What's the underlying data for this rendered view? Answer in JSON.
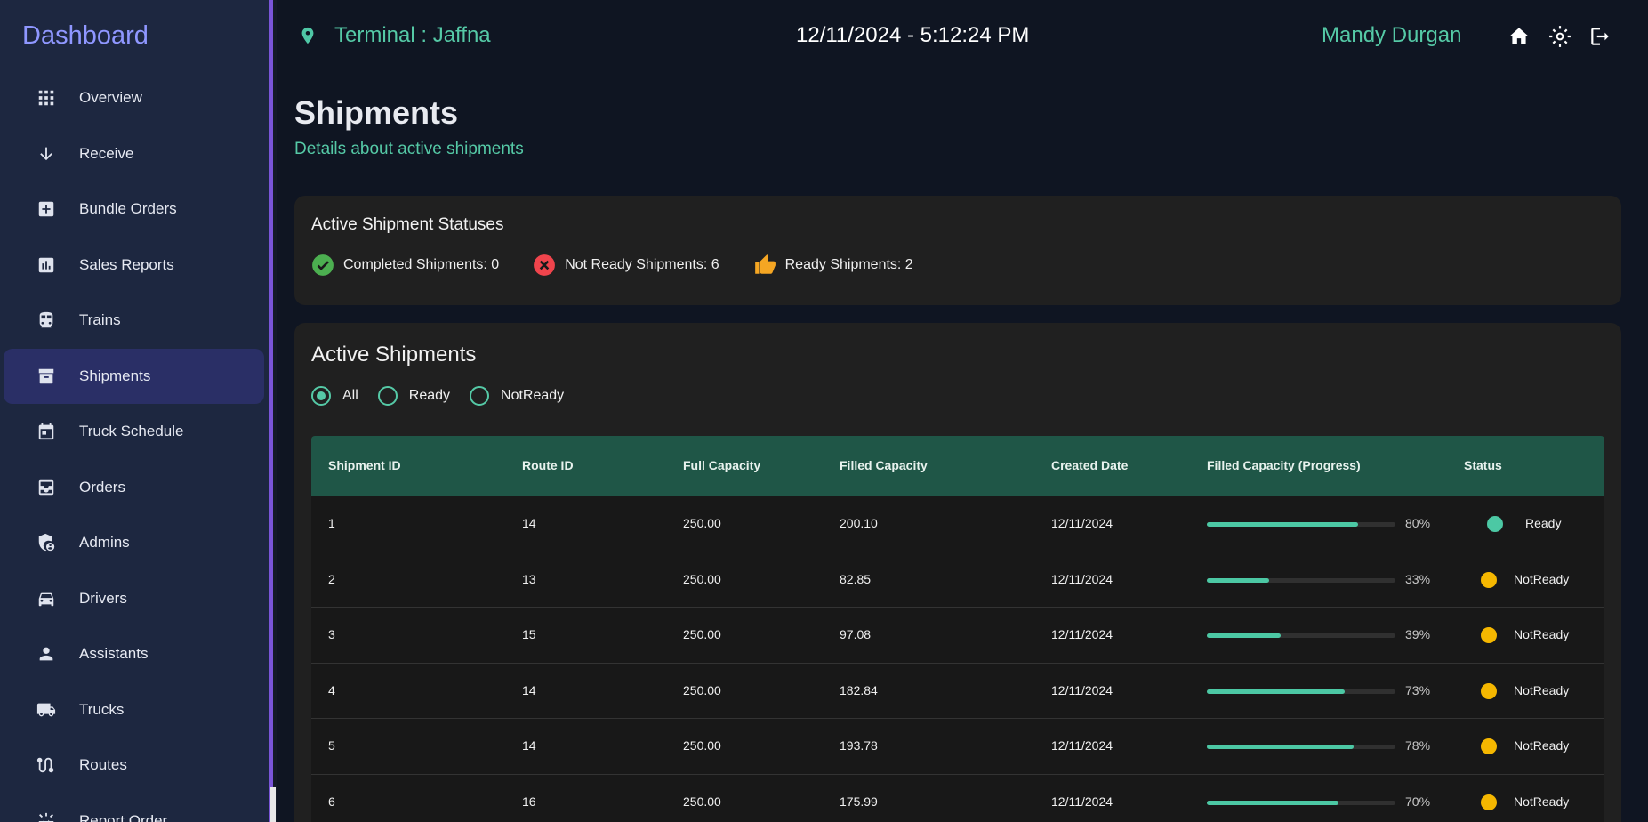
{
  "sidebar": {
    "title": "Dashboard",
    "items": [
      {
        "label": "Overview",
        "icon": "grid-icon"
      },
      {
        "label": "Receive",
        "icon": "arrow-down-icon"
      },
      {
        "label": "Bundle Orders",
        "icon": "add-box-icon"
      },
      {
        "label": "Sales Reports",
        "icon": "bar-chart-icon"
      },
      {
        "label": "Trains",
        "icon": "train-icon"
      },
      {
        "label": "Shipments",
        "icon": "archive-icon"
      },
      {
        "label": "Truck Schedule",
        "icon": "calendar-icon"
      },
      {
        "label": "Orders",
        "icon": "inbox-icon"
      },
      {
        "label": "Admins",
        "icon": "admin-shield-icon"
      },
      {
        "label": "Drivers",
        "icon": "car-icon"
      },
      {
        "label": "Assistants",
        "icon": "person-icon"
      },
      {
        "label": "Trucks",
        "icon": "truck-icon"
      },
      {
        "label": "Routes",
        "icon": "route-icon"
      },
      {
        "label": "Report Order",
        "icon": "report-icon"
      }
    ],
    "active_index": 5
  },
  "header": {
    "terminal": "Terminal : Jaffna",
    "datetime": "12/11/2024 - 5:12:24 PM",
    "user": "Mandy Durgan"
  },
  "page": {
    "title": "Shipments",
    "subtitle": "Details about active shipments"
  },
  "statuses": {
    "heading": "Active Shipment Statuses",
    "completed": "Completed Shipments: 0",
    "not_ready": "Not Ready Shipments: 6",
    "ready": "Ready Shipments: 2"
  },
  "active": {
    "heading": "Active Shipments",
    "filters": [
      "All",
      "Ready",
      "NotReady"
    ],
    "selected_filter": "All"
  },
  "table": {
    "columns": [
      "Shipment ID",
      "Route ID",
      "Full Capacity",
      "Filled Capacity",
      "Created Date",
      "Filled Capacity (Progress)",
      "Status"
    ],
    "rows": [
      {
        "id": "1",
        "route": "14",
        "full": "250.00",
        "filled": "200.10",
        "date": "12/11/2024",
        "pct": "80%",
        "progress": 0.8,
        "status": "Ready"
      },
      {
        "id": "2",
        "route": "13",
        "full": "250.00",
        "filled": "82.85",
        "date": "12/11/2024",
        "pct": "33%",
        "progress": 0.33,
        "status": "NotReady"
      },
      {
        "id": "3",
        "route": "15",
        "full": "250.00",
        "filled": "97.08",
        "date": "12/11/2024",
        "pct": "39%",
        "progress": 0.39,
        "status": "NotReady"
      },
      {
        "id": "4",
        "route": "14",
        "full": "250.00",
        "filled": "182.84",
        "date": "12/11/2024",
        "pct": "73%",
        "progress": 0.73,
        "status": "NotReady"
      },
      {
        "id": "5",
        "route": "14",
        "full": "250.00",
        "filled": "193.78",
        "date": "12/11/2024",
        "pct": "78%",
        "progress": 0.78,
        "status": "NotReady"
      },
      {
        "id": "6",
        "route": "16",
        "full": "250.00",
        "filled": "175.99",
        "date": "12/11/2024",
        "pct": "70%",
        "progress": 0.7,
        "status": "NotReady"
      }
    ],
    "status_colors": {
      "Ready": "#4cc8a4",
      "NotReady": "#f5b700"
    }
  }
}
